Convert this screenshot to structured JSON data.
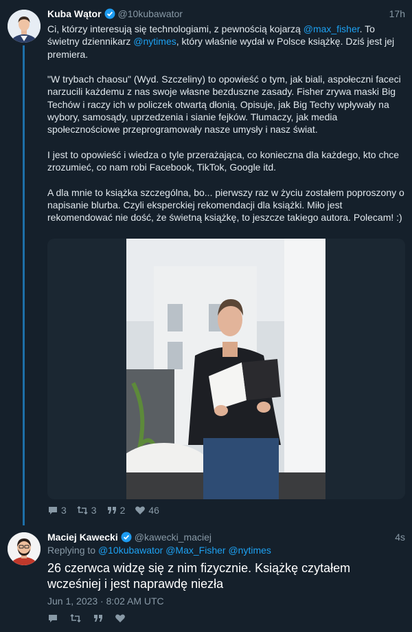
{
  "tweet1": {
    "name": "Kuba Wątor",
    "handle": "@10kubawator",
    "time": "17h",
    "p1_a": "Ci, którzy interesują się technologiami, z pewnością kojarzą ",
    "p1_m1": "@max_fisher",
    "p1_b": ". To świetny dziennikarz ",
    "p1_m2": "@nytimes",
    "p1_c": ", który właśnie wydał w Polsce książkę. Dziś jest jej premiera.",
    "p2": "\"W trybach chaosu\" (Wyd. Szczeliny) to opowieść o tym, jak biali, aspołeczni faceci narzucili każdemu z nas swoje własne bezduszne zasady. Fisher zrywa maski Big Techów i raczy ich w policzek otwartą dłonią. Opisuje, jak Big Techy wpływały na wybory, samosądy, uprzedzenia i sianie fejków. Tłumaczy, jak media społecznościowe przeprogramowały nasze umysły i nasz świat.",
    "p3": "I jest to opowieść i wiedza o tyle przerażająca, co konieczna dla każdego, kto chce zrozumieć, co nam robi Facebook, TikTok, Google itd.",
    "p4": "A dla mnie to książka szczególna, bo... pierwszy raz w życiu zostałem poproszony o napisanie blurba. Czyli eksperckiej rekomendacji dla książki. Miło jest rekomendować nie dość, że świetną książkę, to jeszcze takiego autora. Polecam! :)",
    "stats": {
      "replies": "3",
      "retweets": "3",
      "quotes": "2",
      "likes": "46"
    }
  },
  "tweet2": {
    "name": "Maciej Kawecki",
    "handle": "@kawecki_maciej",
    "time": "4s",
    "replying_label": "Replying to",
    "replying_to": [
      "@10kubawator",
      "@Max_Fisher",
      "@nytimes"
    ],
    "text": "26 czerwca widzę się z nim fizycznie. Książkę czytałem wcześniej i jest naprawdę niezła",
    "date": "Jun 1, 2023 · 8:02 AM UTC"
  },
  "icons": {
    "reply": "comment-icon",
    "retweet": "retweet-icon",
    "quote": "quote-icon",
    "like": "heart-icon",
    "verified": "verified-badge-icon"
  },
  "colors": {
    "background": "#15202b",
    "link": "#1da1f2",
    "muted": "#8899a6",
    "thread_line": "#1d6fa8"
  }
}
